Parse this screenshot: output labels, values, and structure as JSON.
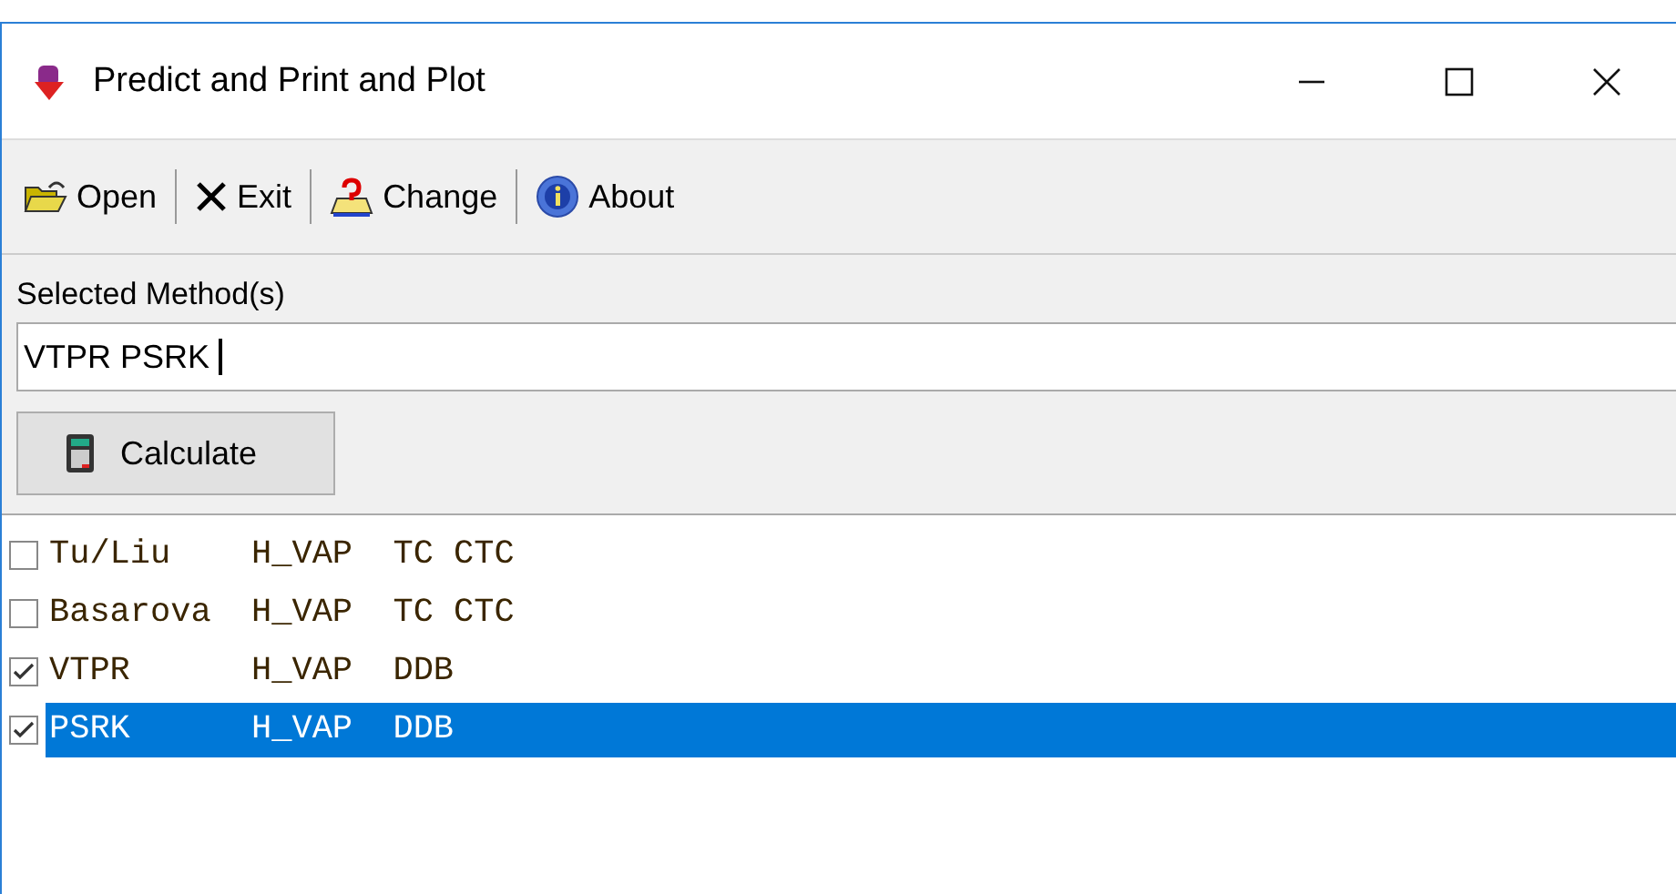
{
  "window": {
    "title": "Predict and Print and Plot"
  },
  "toolbar": [
    {
      "label": "Open",
      "kind": "open"
    },
    {
      "label": "Exit",
      "kind": "exit"
    },
    {
      "label": "Change",
      "kind": "change"
    },
    {
      "label": "About",
      "kind": "about"
    }
  ],
  "methods_field": {
    "label": "Selected Method(s)",
    "value": "VTPR PSRK "
  },
  "calculate_button": {
    "label": "Calculate"
  },
  "methods_list": [
    {
      "text": "Tu/Liu    H_VAP  TC CTC",
      "checked": false,
      "selected": false
    },
    {
      "text": "Basarova  H_VAP  TC CTC",
      "checked": false,
      "selected": false
    },
    {
      "text": "VTPR      H_VAP  DDB",
      "checked": true,
      "selected": false
    },
    {
      "text": "PSRK      H_VAP  DDB",
      "checked": true,
      "selected": true
    }
  ]
}
